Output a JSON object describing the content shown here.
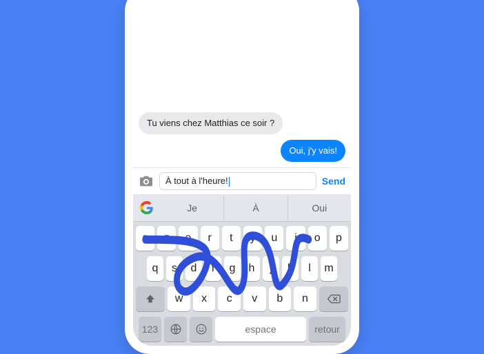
{
  "colors": {
    "background": "#4a80f5",
    "outgoing_bubble": "#0b84ff",
    "swipe": "#2f4fd8"
  },
  "conversation": {
    "incoming": "Tu viens chez Matthias ce soir ?",
    "outgoing": "Oui, j'y vais!"
  },
  "input": {
    "text": "À tout à l'heure!",
    "send_label": "Send"
  },
  "suggestions": [
    "Je",
    "À",
    "Oui"
  ],
  "keyboard": {
    "row1": [
      "a",
      "z",
      "e",
      "r",
      "t",
      "y",
      "u",
      "i",
      "o",
      "p"
    ],
    "row2": [
      "q",
      "s",
      "d",
      "f",
      "g",
      "h",
      "j",
      "k",
      "l",
      "m"
    ],
    "row3": [
      "w",
      "x",
      "c",
      "v",
      "b",
      "n"
    ],
    "numbers_key": "123",
    "space_label": "espace",
    "return_label": "retour"
  }
}
